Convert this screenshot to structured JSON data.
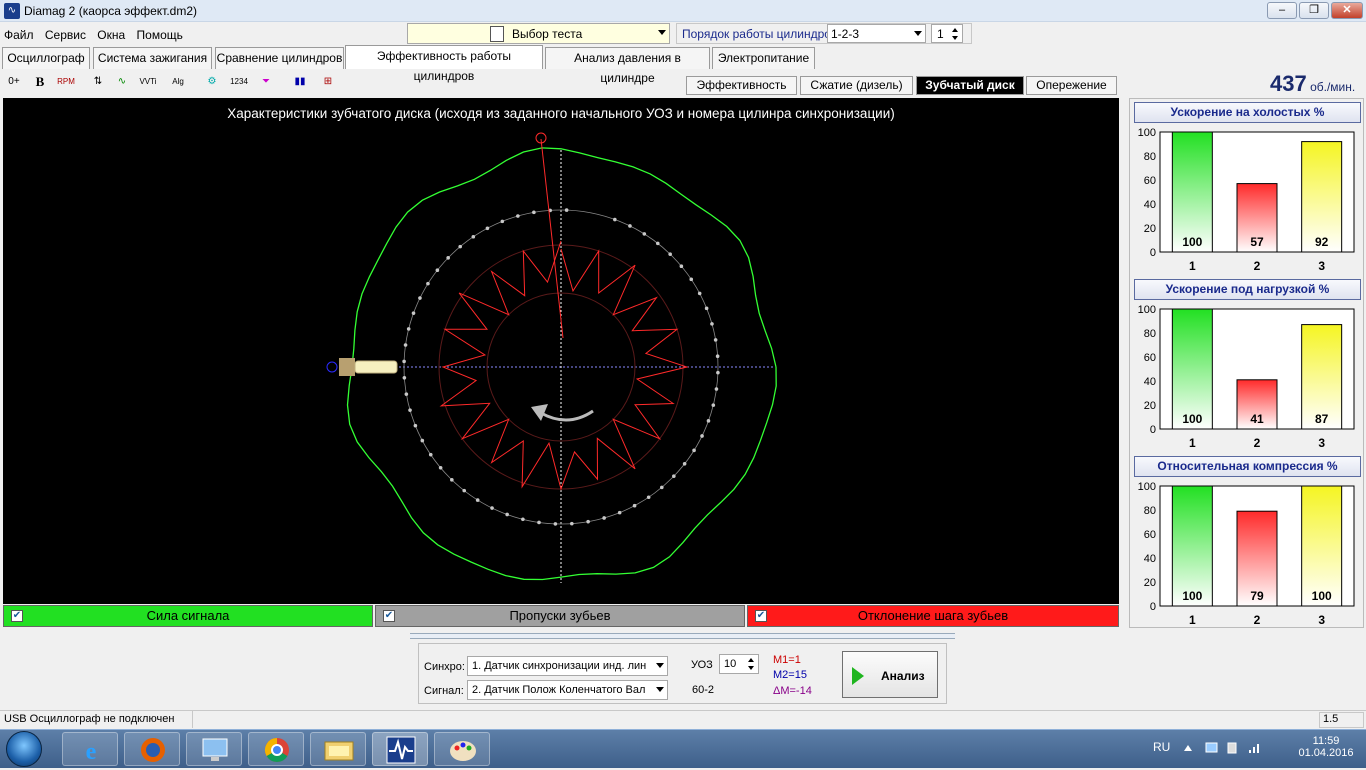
{
  "window": {
    "title": "Diamag 2 (каорса эффект.dm2)",
    "app_icon": "oscilloscope-wave-icon"
  },
  "menu": [
    "Файл",
    "Сервис",
    "Окна",
    "Помощь"
  ],
  "test_select": {
    "label": "Выбор теста",
    "icon": "test-settings-icon"
  },
  "cylinder_order": {
    "label": "Порядок работы цилиндров",
    "value": "1-2-3",
    "spin_value": "1"
  },
  "main_tabs": [
    "Осциллограф",
    "Система зажигания",
    "Сравнение цилиндров",
    "Эффективность работы цилиндров",
    "Анализ давления в цилиндре",
    "Электропитание"
  ],
  "active_main_tab": "Эффективность работы цилиндров",
  "toolbar_icons": [
    "zero-offset-icon",
    "bold-icon",
    "rpm-icon",
    "sort-icon",
    "trend-icon",
    "vvti-icon",
    "alg-icon",
    "filter-icon",
    "counter-icon",
    "funnel-icon",
    "bar-chart-icon",
    "trigger-icon"
  ],
  "sub_tabs": [
    "Эффективность",
    "Сжатие (дизель)",
    "Зубчатый диск",
    "Опережение"
  ],
  "active_sub_tab": "Зубчатый диск",
  "rpm": {
    "value": "437",
    "unit": "об./мин."
  },
  "plot": {
    "title": "Характеристики зубчатого диска (исходя из заданного начального УОЗ и номера цилинра синхронизации)",
    "colors": {
      "signal": "#33ff33",
      "teeth": "#c8c8c8",
      "deviation": "#ff2a2a",
      "axes": "#ffffff",
      "sensor": "#2a2aff"
    }
  },
  "signal_bars": [
    {
      "label": "Сила сигнала",
      "color": "#22e022",
      "checked": "✔"
    },
    {
      "label": "Пропуски зубьев",
      "color": "#a0a0a0",
      "checked": "✔"
    },
    {
      "label": "Отклонение шага зубьев",
      "color": "#ff1a1a",
      "checked": "✔"
    }
  ],
  "charts": [
    {
      "title": "Ускорение на холостых %",
      "yticks": [
        "100",
        "80",
        "60",
        "40",
        "20",
        "0"
      ],
      "categories": [
        "1",
        "2",
        "3"
      ],
      "values": [
        100,
        57,
        92
      ],
      "colors": [
        "#22e022",
        "#ff2a2a",
        "#f5f522"
      ]
    },
    {
      "title": "Ускорение под нагрузкой %",
      "yticks": [
        "100",
        "80",
        "60",
        "40",
        "20",
        "0"
      ],
      "categories": [
        "1",
        "2",
        "3"
      ],
      "values": [
        100,
        41,
        87
      ],
      "colors": [
        "#22e022",
        "#ff2a2a",
        "#f5f522"
      ]
    },
    {
      "title": "Относительная компрессия %",
      "yticks": [
        "100",
        "80",
        "60",
        "40",
        "20",
        "0"
      ],
      "categories": [
        "1",
        "2",
        "3"
      ],
      "values": [
        100,
        79,
        100
      ],
      "colors": [
        "#22e022",
        "#ff2a2a",
        "#f5f522"
      ]
    }
  ],
  "chart_data": [
    {
      "type": "bar",
      "title": "Ускорение на холостых %",
      "categories": [
        "1",
        "2",
        "3"
      ],
      "values": [
        100,
        57,
        92
      ],
      "ylim": [
        0,
        100
      ]
    },
    {
      "type": "bar",
      "title": "Ускорение под нагрузкой %",
      "categories": [
        "1",
        "2",
        "3"
      ],
      "values": [
        100,
        41,
        87
      ],
      "ylim": [
        0,
        100
      ]
    },
    {
      "type": "bar",
      "title": "Относительная компрессия %",
      "categories": [
        "1",
        "2",
        "3"
      ],
      "values": [
        100,
        79,
        100
      ],
      "ylim": [
        0,
        100
      ]
    }
  ],
  "controls": {
    "sync_label": "Синхро:",
    "sync_value": "1.  Датчик синхронизации инд. лин",
    "signal_label": "Сигнал:",
    "signal_value": "2.  Датчик Полож Коленчатого Вал",
    "uoz_label": "УОЗ",
    "uoz_value": "10",
    "teeth": "60-2",
    "m1": "M1=1",
    "m2": "M2=15",
    "dm": "ΔM=-14",
    "analyze_label": "Анализ"
  },
  "status": {
    "text": "USB Осциллограф не подключен",
    "right": "1.5"
  },
  "taskbar": {
    "lang": "RU",
    "time": "11:59",
    "date": "01.04.2016"
  }
}
